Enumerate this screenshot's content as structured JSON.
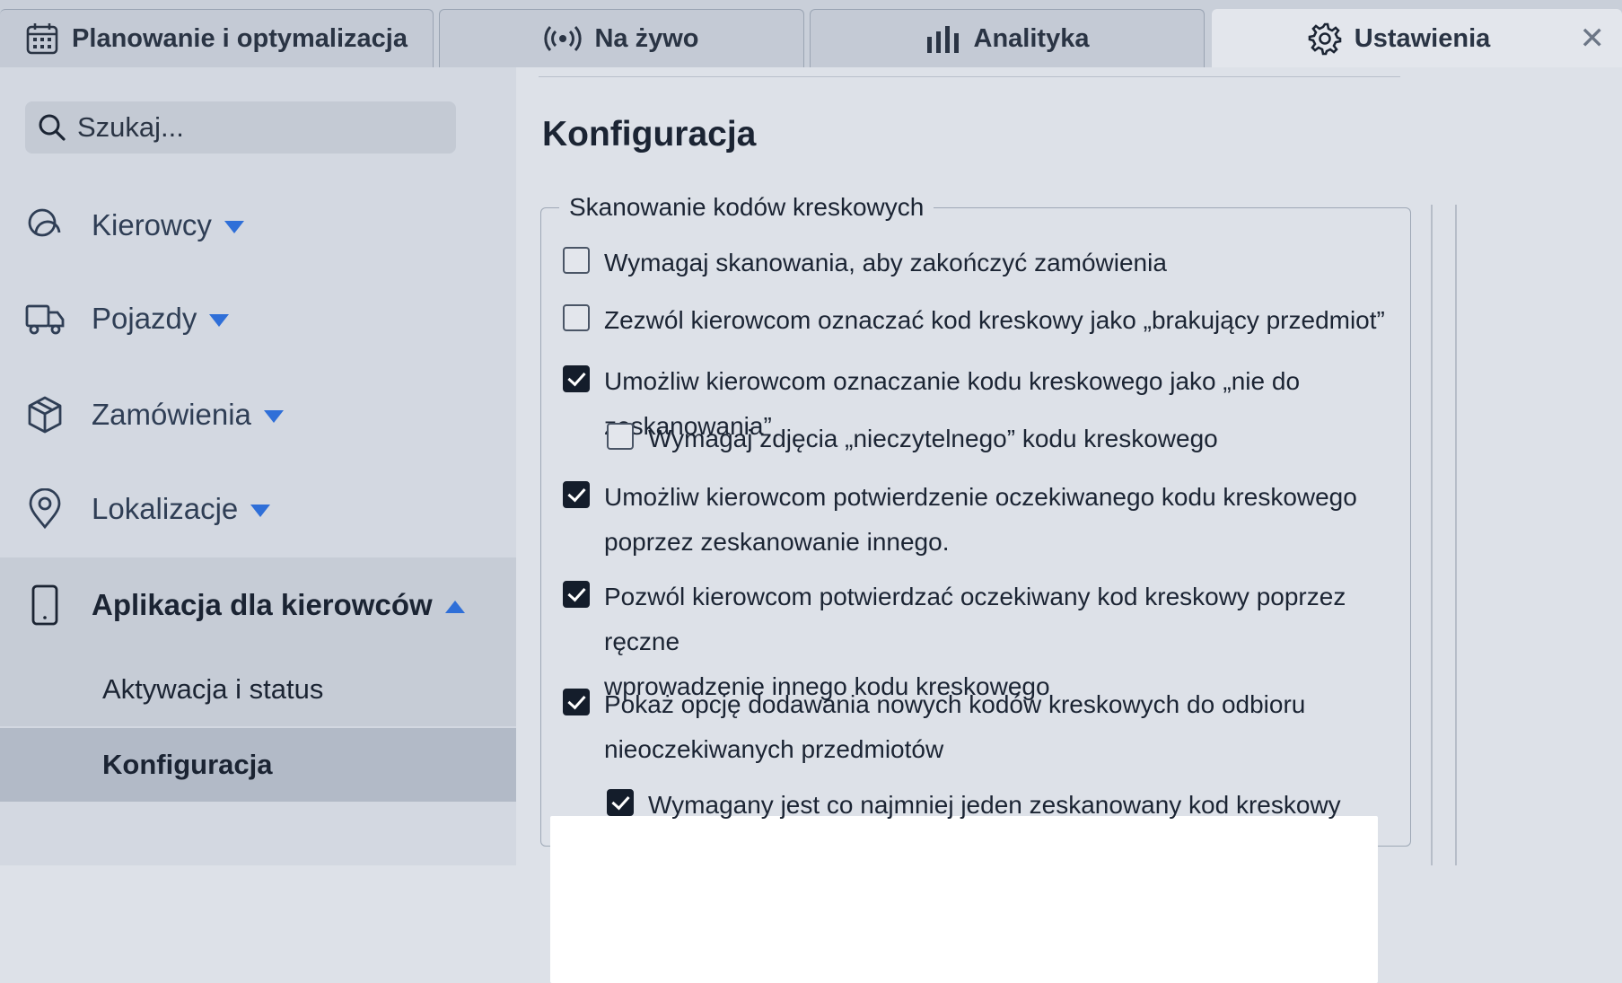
{
  "tabs": [
    {
      "label": "Planowanie i optymalizacja",
      "icon": "calendar-icon",
      "active": false
    },
    {
      "label": "Na żywo",
      "icon": "broadcast-icon",
      "active": false
    },
    {
      "label": "Analityka",
      "icon": "bar-chart-icon",
      "active": false
    },
    {
      "label": "Ustawienia",
      "icon": "gear-icon",
      "active": true
    }
  ],
  "close_icon": "close-icon",
  "sidebar": {
    "search_placeholder": "Szukaj...",
    "items": [
      {
        "label": "Kierowcy",
        "icon": "drivers-icon",
        "expanded": false
      },
      {
        "label": "Pojazdy",
        "icon": "truck-icon",
        "expanded": false
      },
      {
        "label": "Zamówienia",
        "icon": "package-icon",
        "expanded": false
      },
      {
        "label": "Lokalizacje",
        "icon": "location-pin-icon",
        "expanded": false
      },
      {
        "label": "Aplikacja dla kierowców",
        "icon": "phone-icon",
        "expanded": true
      }
    ],
    "subitems": [
      {
        "label": "Aktywacja i status",
        "selected": false
      },
      {
        "label": "Konfiguracja",
        "selected": true
      }
    ]
  },
  "main": {
    "title": "Konfiguracja",
    "section": {
      "legend": "Skanowanie kodów kreskowych",
      "options": [
        {
          "lines": [
            "Wymagaj skanowania, aby zakończyć zamówienia"
          ],
          "checked": false
        },
        {
          "lines": [
            "Zezwól kierowcom oznaczać kod kreskowy jako „brakujący przedmiot”"
          ],
          "checked": false
        },
        {
          "lines": [
            "Umożliw kierowcom oznaczanie kodu kreskowego jako „nie do zeskanowania”"
          ],
          "checked": true
        },
        {
          "lines": [
            "Wymagaj zdjęcia „nieczytelnego” kodu kreskowego"
          ],
          "checked": false
        },
        {
          "lines": [
            "Umożliw kierowcom potwierdzenie oczekiwanego kodu kreskowego",
            "poprzez zeskanowanie innego."
          ],
          "checked": true
        },
        {
          "lines": [
            "Pozwól kierowcom potwierdzać oczekiwany kod kreskowy poprzez ręczne",
            "wprowadzenie innego kodu kreskowego"
          ],
          "checked": true
        },
        {
          "lines": [
            "Pokaż opcję dodawania nowych kodów kreskowych do odbioru",
            "nieoczekiwanych przedmiotów"
          ],
          "checked": true
        },
        {
          "lines": [
            "Wymagany jest co najmniej jeden zeskanowany kod kreskowy"
          ],
          "checked": true
        }
      ]
    }
  },
  "colors": {
    "accent": "#2f6fd8",
    "checkbox_checked": "#141d2b",
    "highlight": "#ffffff"
  }
}
